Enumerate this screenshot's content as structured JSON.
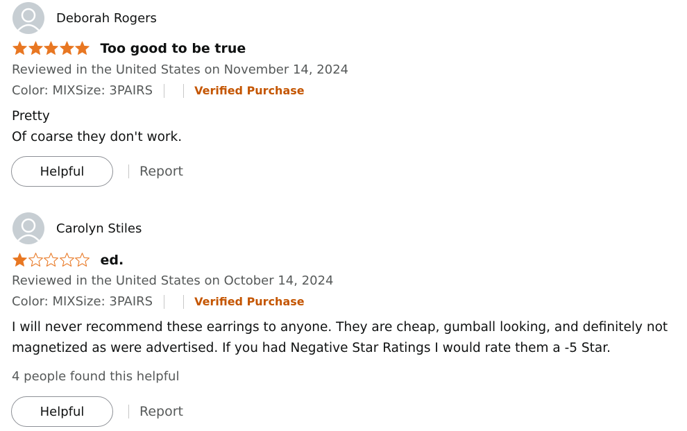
{
  "reviews": [
    {
      "author": "Deborah Rogers",
      "rating": 5,
      "title": "Too good to be true",
      "date_text": "Reviewed in the United States on November 14, 2024",
      "variant": "Color: MIXSize: 3PAIRS",
      "verified": "Verified Purchase",
      "body_lines": [
        "Pretty",
        "Of coarse they don't work."
      ],
      "helpful_label": "Helpful",
      "report_label": "Report"
    },
    {
      "author": "Carolyn Stiles",
      "rating": 1,
      "title": "ed.",
      "date_text": "Reviewed in the United States on October 14, 2024",
      "variant": "Color: MIXSize: 3PAIRS",
      "verified": "Verified Purchase",
      "body_lines": [
        "I will never recommend these earrings to anyone. They are cheap, gumball looking, and definitely not magnetized as were advertised. If you had Negative Star Ratings I would rate them a -5 Star."
      ],
      "helpful_count": "4 people found this helpful",
      "helpful_label": "Helpful",
      "report_label": "Report"
    }
  ],
  "colors": {
    "star": "#e87722",
    "verified": "#c45500",
    "muted": "#565959"
  },
  "icons": {
    "avatar": "person-silhouette-icon",
    "star": "star-icon"
  }
}
